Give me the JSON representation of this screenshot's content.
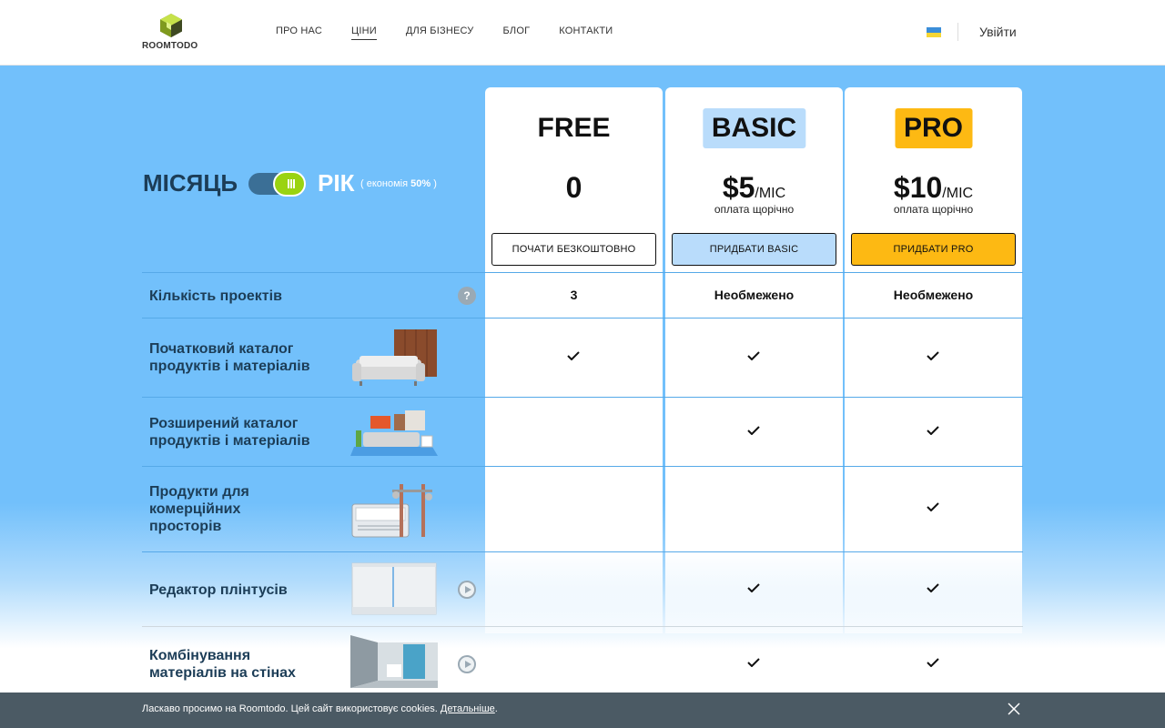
{
  "header": {
    "logo_text": "ROOMTODO",
    "nav": [
      {
        "label": "ПРО НАС",
        "active": false
      },
      {
        "label": "ЦІНИ",
        "active": true
      },
      {
        "label": "ДЛЯ БІЗНЕСУ",
        "active": false
      },
      {
        "label": "БЛОГ",
        "active": false
      },
      {
        "label": "КОНТАКТИ",
        "active": false
      }
    ],
    "login_label": "Увійти",
    "flag": "ukraine-flag-icon"
  },
  "billing": {
    "month_label": "МІСЯЦЬ",
    "year_label": "РІК",
    "selected": "year",
    "saving_prefix": "( економія ",
    "saving_value": "50%",
    "saving_suffix": " )"
  },
  "plans": [
    {
      "name": "FREE",
      "price": "0",
      "per": "",
      "note": "",
      "button": "ПОЧАТИ БЕЗКОШТОВНО",
      "color": "#ffffff"
    },
    {
      "name": "BASIC",
      "price": "$5",
      "per": "/МІС",
      "note": "оплата щорічно",
      "button": "ПРИДБАТИ BASIC",
      "color": "#b9dcfb"
    },
    {
      "name": "PRO",
      "price": "$10",
      "per": "/МІС",
      "note": "оплата щорічно",
      "button": "ПРИДБАТИ PRO",
      "color": "#fdb913"
    }
  ],
  "features": [
    {
      "label": "Кількість проектів",
      "free": "3",
      "basic": "Необмежено",
      "pro": "Необмежено",
      "icon": "help-icon"
    },
    {
      "label": "Початковий каталог продуктів і матеріалів",
      "free": true,
      "basic": true,
      "pro": true
    },
    {
      "label": "Розширений каталог продуктів і матеріалів",
      "free": false,
      "basic": true,
      "pro": true
    },
    {
      "label": "Продукти для комерційних просторів",
      "free": false,
      "basic": false,
      "pro": true
    },
    {
      "label": "Редактор плінтусів",
      "free": false,
      "basic": true,
      "pro": true,
      "icon": "play-icon"
    },
    {
      "label": "Комбінування матеріалів на стінах",
      "free": false,
      "basic": true,
      "pro": true,
      "icon": "play-icon"
    }
  ],
  "help_glyph": "?",
  "cookie": {
    "text": "Ласкаво просимо на Roomtodo. Цей сайт використовує cookies. ",
    "link": "Детальніше",
    "end": "."
  },
  "colors": {
    "background_blue": "#72c0fb",
    "accent_green": "#9ad311",
    "pro_yellow": "#fdb913",
    "basic_blue": "#b9dcfb",
    "heading_dark": "#1c3d57",
    "cookie_bar": "#4b5a64"
  }
}
